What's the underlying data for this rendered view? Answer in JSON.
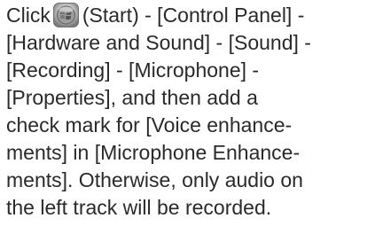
{
  "instructions": {
    "line1_before_icon": "Click",
    "start_icon": "windows-start-orb-icon",
    "line1_after_icon": "(Start) - [Control Panel] -",
    "line2": "[Hardware and Sound] - [Sound] -",
    "line3": "[Recording] - [Microphone] -",
    "line4": "[Properties], and then add a",
    "line5": "check mark for [Voice enhance-",
    "line6": "ments] in [Microphone Enhance-",
    "line7": "ments]. Otherwise, only audio on",
    "line8": "the left track will be recorded."
  }
}
